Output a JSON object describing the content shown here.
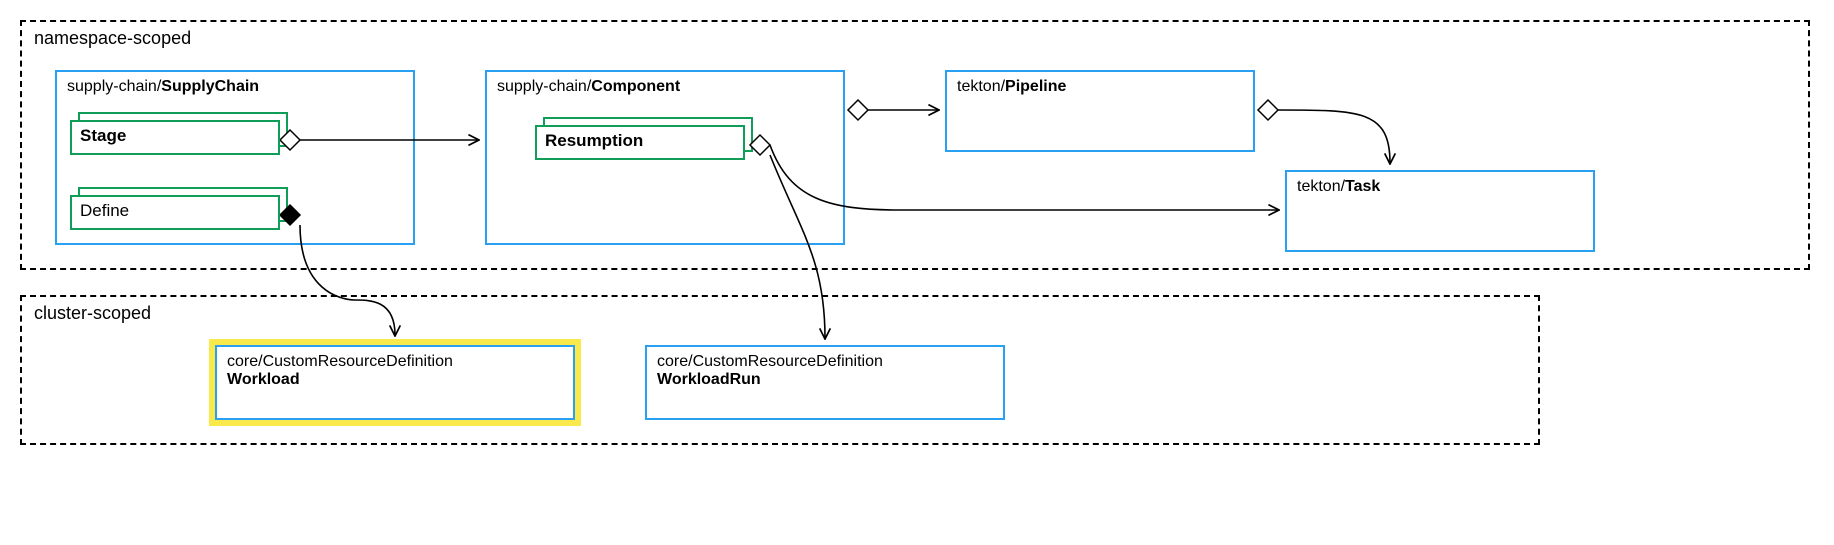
{
  "scopes": {
    "namespace": "namespace-scoped",
    "cluster": "cluster-scoped"
  },
  "boxes": {
    "supplychain": {
      "prefix": "supply-chain/",
      "name": "SupplyChain"
    },
    "component": {
      "prefix": "supply-chain/",
      "name": "Component"
    },
    "pipeline": {
      "prefix": "tekton/",
      "name": "Pipeline"
    },
    "task": {
      "prefix": "tekton/",
      "name": "Task"
    },
    "workload": {
      "prefix": "core/CustomResourceDefinition",
      "name": "Workload"
    },
    "workloadrun": {
      "prefix": "core/CustomResourceDefinition",
      "name": "WorkloadRun"
    }
  },
  "cards": {
    "stage": "Stage",
    "define": "Define",
    "resumption": "Resumption"
  }
}
